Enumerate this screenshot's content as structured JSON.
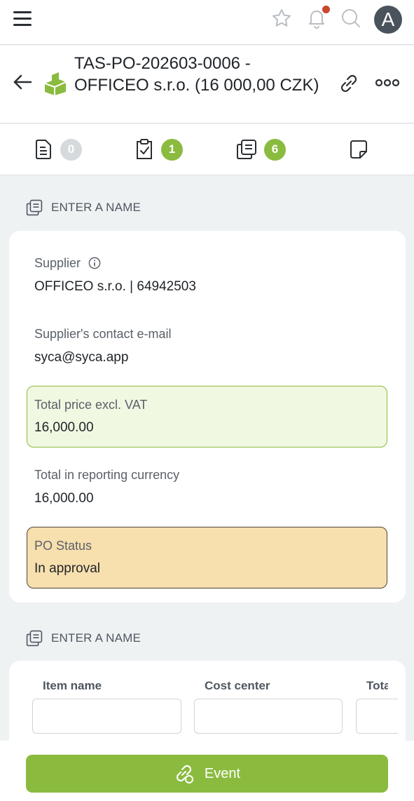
{
  "topbar": {
    "icons": [
      "menu-icon",
      "star-icon",
      "bell-icon",
      "search-icon"
    ],
    "avatar_initial": "A",
    "notification_dot_color": "#c8472f"
  },
  "header": {
    "title": "TAS-PO-202603-0006 - OFFICEO s.r.o. (16 000,00 CZK)",
    "icons": [
      "back-arrow-icon",
      "document-logo-icon",
      "link-icon",
      "more-icon"
    ]
  },
  "tabs": [
    {
      "icon": "document-icon",
      "count": "0"
    },
    {
      "icon": "clipboard-check-icon",
      "count": "1"
    },
    {
      "icon": "copy-docs-icon",
      "count": "6"
    },
    {
      "icon": "note-icon"
    }
  ],
  "section1": {
    "title": "ENTER A NAME",
    "supplier_label": "Supplier",
    "supplier_value": "OFFICEO s.r.o. | 64942503",
    "email_label": "Supplier's contact e-mail",
    "email_value": "syca@syca.app",
    "total_label": "Total price excl. VAT",
    "total_value": "16,000.00",
    "reporting_label": "Total in reporting currency",
    "reporting_value": "16,000.00",
    "status_label": "PO Status",
    "status_value": "In approval"
  },
  "section2": {
    "title": "ENTER A NAME",
    "columns": [
      "Item name",
      "Cost center",
      "Tota"
    ]
  },
  "footer": {
    "event_label": "Event"
  },
  "colors": {
    "accent_green": "#8abb3f",
    "status_orange": "#f7dfae"
  }
}
